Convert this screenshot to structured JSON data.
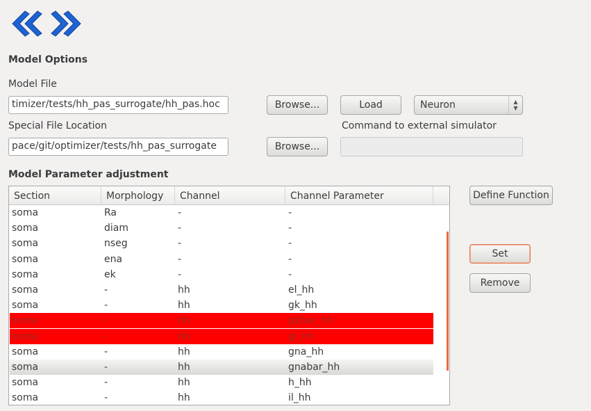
{
  "nav": {
    "back_icon": "double-chevron-left-icon",
    "forward_icon": "double-chevron-right-icon",
    "color": "#1e63d2"
  },
  "model_options": {
    "title": "Model Options",
    "model_file_label": "Model File",
    "model_file_value": "timizer/tests/hh_pas_surrogate/hh_pas.hoc",
    "browse_label": "Browse...",
    "load_label": "Load",
    "simulator_selected": "Neuron",
    "special_file_label": "Special File Location",
    "special_file_value": "pace/git/optimizer/tests/hh_pas_surrogate",
    "browse2_label": "Browse...",
    "command_label": "Command to external simulator",
    "command_value": ""
  },
  "param_adjust": {
    "title": "Model  Parameter adjustment",
    "columns": [
      "Section",
      "Morphology",
      "Channel",
      "Channel Parameter"
    ],
    "rows": [
      [
        "soma",
        "Ra",
        "-",
        "-"
      ],
      [
        "soma",
        "diam",
        "-",
        "-"
      ],
      [
        "soma",
        "nseg",
        "-",
        "-"
      ],
      [
        "soma",
        "ena",
        "-",
        "-"
      ],
      [
        "soma",
        "ek",
        "-",
        "-"
      ],
      [
        "soma",
        "-",
        "hh",
        "el_hh"
      ],
      [
        "soma",
        "-",
        "hh",
        "gk_hh"
      ],
      [
        "soma",
        "-",
        "hh",
        "gkbar_hh"
      ],
      [
        "soma",
        "-",
        "hh",
        "gl_hh"
      ],
      [
        "soma",
        "-",
        "hh",
        "gna_hh"
      ],
      [
        "soma",
        "-",
        "hh",
        "gnabar_hh"
      ],
      [
        "soma",
        "-",
        "hh",
        "h_hh"
      ],
      [
        "soma",
        "-",
        "hh",
        "il_hh"
      ]
    ],
    "highlighted_rows": [
      7,
      8
    ],
    "selected_row": 10,
    "highlight_color": "#ff0000",
    "define_function_label": "Define Function",
    "set_label": "Set",
    "remove_label": "Remove"
  }
}
